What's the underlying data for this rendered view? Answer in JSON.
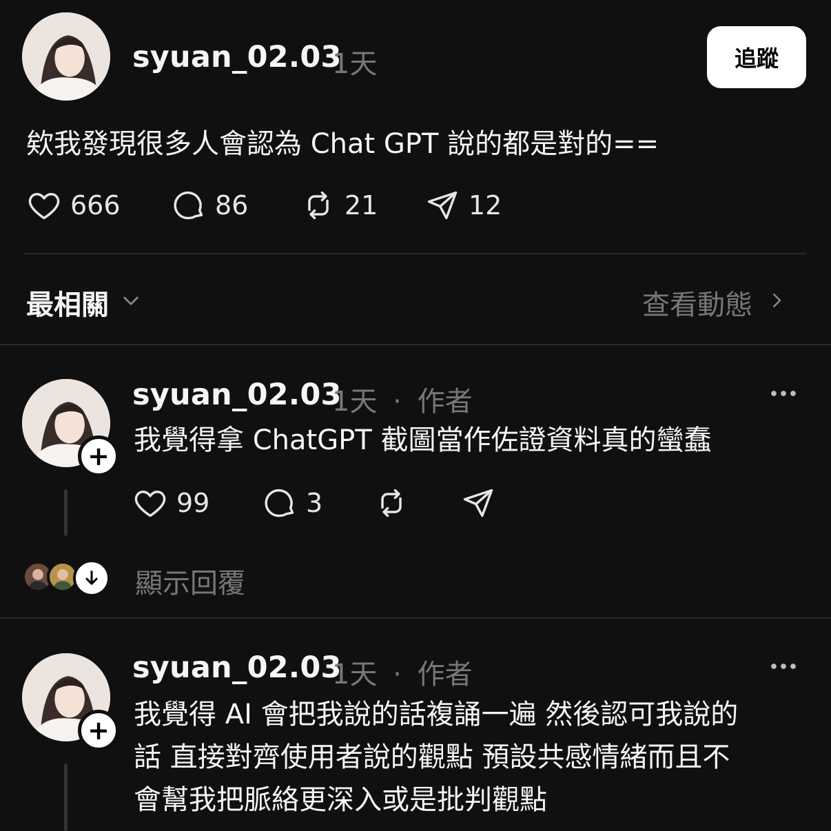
{
  "post": {
    "username": "syuan_02.03",
    "time": "1天",
    "follow_label": "追蹤",
    "text": "欸我發現很多人會認為 Chat GPT 說的都是對的==",
    "likes": "666",
    "comments": "86",
    "reposts": "21",
    "shares": "12"
  },
  "sort_bar": {
    "label": "最相關",
    "activity_label": "查看動態"
  },
  "replies": [
    {
      "username": "syuan_02.03",
      "time": "1天",
      "dot": "·",
      "role": "作者",
      "text": "我覺得拿 ChatGPT 截圖當作佐證資料真的蠻蠢",
      "likes": "99",
      "comments": "3",
      "show_replies_label": "顯示回覆"
    },
    {
      "username": "syuan_02.03",
      "time": "1天",
      "dot": "·",
      "role": "作者",
      "text_lines": [
        "我覺得 AI 會把我說的話複誦一遍 然後認可我說的",
        "話 直接對齊使用者說的觀點 預設共感情緒而且不",
        "會幫我把脈絡更深入或是批判觀點"
      ]
    }
  ],
  "icons": {
    "like": "heart-icon",
    "comment": "comment-icon",
    "repost": "repost-icon",
    "share": "send-icon",
    "more": "more-icon",
    "chevron_down": "chevron-down-icon",
    "chevron_right": "chevron-right-icon",
    "plus": "plus-icon",
    "arrow_down": "arrow-down-icon"
  },
  "colors": {
    "background": "#101010",
    "text": "#f3f5f7",
    "muted": "#777777",
    "button": "#ffffff"
  }
}
